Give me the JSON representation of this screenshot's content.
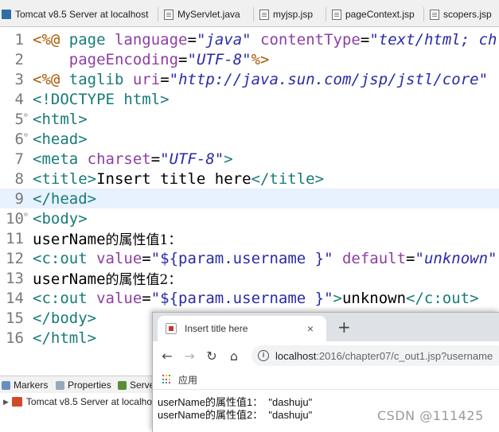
{
  "editor_tabs": [
    {
      "label": "Tomcat v8.5 Server at localhost",
      "icon": "server-icon"
    },
    {
      "label": "MyServlet.java",
      "icon": "java-file-icon"
    },
    {
      "label": "myjsp.jsp",
      "icon": "jsp-file-icon"
    },
    {
      "label": "pageContext.jsp",
      "icon": "jsp-file-icon"
    },
    {
      "label": "scopers.jsp",
      "icon": "jsp-file-icon"
    }
  ],
  "code": {
    "line_numbers": [
      "1",
      "2",
      "3",
      "4",
      "5",
      "6",
      "7",
      "8",
      "9",
      "10",
      "11",
      "12",
      "13",
      "14",
      "15",
      "16"
    ],
    "l1": {
      "open": "<%@ ",
      "kw": "page",
      "a1": "language",
      "eq1": "=",
      "v1": "\"java\"",
      "a2": "contentType",
      "eq2": "=",
      "v2": "\"text/html; ch"
    },
    "l2": {
      "a1": "pageEncoding",
      "eq1": "=",
      "v1": "\"UTF-8\"",
      "close": "%>"
    },
    "l3": {
      "open": "<%@ ",
      "kw": "taglib",
      "a1": "uri",
      "eq1": "=",
      "v1": "\"http://java.sun.com/jsp/jstl/core\""
    },
    "l4": {
      "tag": "<!DOCTYPE html>"
    },
    "l5": {
      "tag": "<html>"
    },
    "l6": {
      "tag": "<head>"
    },
    "l7": {
      "tag": "<meta ",
      "a1": "charset",
      "eq1": "=",
      "v1": "\"UTF-8\"",
      "close": ">"
    },
    "l8": {
      "open": "<title>",
      "text": "Insert title here",
      "close": "</title>"
    },
    "l9": {
      "tag": "</head>"
    },
    "l10": {
      "tag": "<body>"
    },
    "l11": {
      "text": "userName",
      "cn": "的属性值1："
    },
    "l12": {
      "tag": "<c:out ",
      "a1": "value",
      "eq1": "=",
      "v1": "\"${param.username }\"",
      "a2": "default",
      "eq2": "=",
      "v2": "\"unknown\""
    },
    "l13": {
      "text": "userName",
      "cn": "的属性值2："
    },
    "l14": {
      "tag": "<c:out ",
      "a1": "value",
      "eq1": "=",
      "v1": "\"${param.username }\"",
      "close1": ">",
      "text": "unknown",
      "close2": "</c:out>"
    },
    "l15": {
      "tag": "</body>"
    },
    "l16": {
      "tag": "</html>"
    }
  },
  "bottom_panel": {
    "tabs": [
      {
        "label": "Markers",
        "icon": "markers-icon"
      },
      {
        "label": "Properties",
        "icon": "properties-icon"
      },
      {
        "label": "Serve",
        "icon": "servers-icon"
      }
    ],
    "server_row": "Tomcat v8.5 Server at localhos"
  },
  "browser": {
    "tab_title": "Insert title here",
    "close_glyph": "×",
    "new_tab_glyph": "+",
    "url_host": "localhost",
    "url_path": ":2016/chapter07/c_out1.jsp?username",
    "bookmark_apps_label": "应用",
    "output": [
      "userName的属性值1：  \"dashuju\"",
      "userName的属性值2：  \"dashuju\""
    ]
  },
  "watermark": "CSDN @111425",
  "colors": {
    "tag": "#177b78",
    "attribute": "#8e3ea3",
    "value": "#2a2aa8",
    "current_line": "#e8f2fe"
  }
}
